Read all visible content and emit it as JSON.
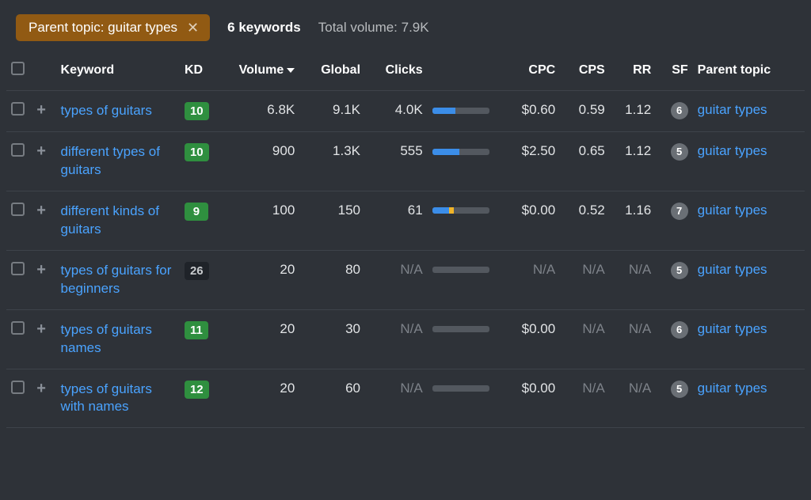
{
  "filter": {
    "label": "Parent topic: guitar types"
  },
  "summary": {
    "count_label": "6 keywords",
    "total_label": "Total volume: 7.9K"
  },
  "columns": {
    "keyword": "Keyword",
    "kd": "KD",
    "volume": "Volume",
    "global": "Global",
    "clicks": "Clicks",
    "cpc": "CPC",
    "cps": "CPS",
    "rr": "RR",
    "sf": "SF",
    "parent": "Parent topic"
  },
  "rows": [
    {
      "keyword": "types of guitars",
      "kd": "10",
      "kd_class": "kd-green",
      "volume": "6.8K",
      "global": "9.1K",
      "clicks": "4.0K",
      "bar_a": 40,
      "bar_b": 0,
      "cpc": "$0.60",
      "cps": "0.59",
      "rr": "1.12",
      "sf": "6",
      "parent": "guitar types"
    },
    {
      "keyword": "different types of guitars",
      "kd": "10",
      "kd_class": "kd-green",
      "volume": "900",
      "global": "1.3K",
      "clicks": "555",
      "bar_a": 48,
      "bar_b": 0,
      "cpc": "$2.50",
      "cps": "0.65",
      "rr": "1.12",
      "sf": "5",
      "parent": "guitar types"
    },
    {
      "keyword": "different kinds of guitars",
      "kd": "9",
      "kd_class": "kd-green",
      "volume": "100",
      "global": "150",
      "clicks": "61",
      "bar_a": 30,
      "bar_b": 8,
      "cpc": "$0.00",
      "cps": "0.52",
      "rr": "1.16",
      "sf": "7",
      "parent": "guitar types"
    },
    {
      "keyword": "types of guitars for beginners",
      "kd": "26",
      "kd_class": "kd-dark",
      "volume": "20",
      "global": "80",
      "clicks": "N/A",
      "bar_a": 0,
      "bar_b": 0,
      "cpc": "N/A",
      "cps": "N/A",
      "rr": "N/A",
      "sf": "5",
      "parent": "guitar types"
    },
    {
      "keyword": "types of guitars names",
      "kd": "11",
      "kd_class": "kd-green",
      "volume": "20",
      "global": "30",
      "clicks": "N/A",
      "bar_a": 0,
      "bar_b": 0,
      "cpc": "$0.00",
      "cps": "N/A",
      "rr": "N/A",
      "sf": "6",
      "parent": "guitar types"
    },
    {
      "keyword": "types of guitars with names",
      "kd": "12",
      "kd_class": "kd-green",
      "volume": "20",
      "global": "60",
      "clicks": "N/A",
      "bar_a": 0,
      "bar_b": 0,
      "cpc": "$0.00",
      "cps": "N/A",
      "rr": "N/A",
      "sf": "5",
      "parent": "guitar types"
    }
  ]
}
